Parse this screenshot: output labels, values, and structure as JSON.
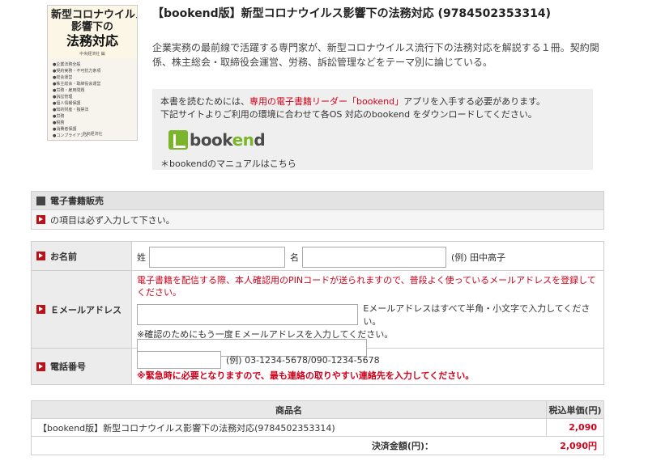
{
  "book": {
    "cover": {
      "title_line1": "新型コロナウイルス",
      "title_line2": "影響下の",
      "title_line3": "法務対応",
      "editor": "中央経済社 編",
      "contents": [
        "●企業法務全般",
        "●契約実務・不可抗力条項",
        "●総会運営",
        "●株主総会・取締役会運営",
        "●労務・雇用問題",
        "●訴訟管理",
        "●個人情報保護",
        "●知的財産・独禁法",
        "●労務",
        "●税務",
        "●消費者保護",
        "●コンプライアンス"
      ],
      "publisher": "中央経済社"
    },
    "title": "【bookend版】新型コロナウイルス影響下の法務対応 (9784502353314)",
    "description": "企業実務の最前線で活躍する専門家が、新型コロナウイルス流行下の法務対応を解説する１冊。契約関係、株主総会・取締役会運営、労務、訴訟管理などをテーマ別に論じている。"
  },
  "bookend": {
    "line1_prefix": "本書を読むためには、",
    "line1_highlight": "専用の電子書籍リーダー「bookend」",
    "line1_suffix": "アプリを入手する必要があります。",
    "line2": "下記サイトよりご利用の環境に合わせて各OS 対応のbookend をダウンロードしてください。",
    "logo_text_a": "book",
    "logo_text_b": "en",
    "logo_text_c": "d",
    "manual_link": "＊bookendのマニュアルはこちら"
  },
  "section": {
    "title": "電子書籍販売",
    "required_note": "の項目は必ず入力して下さい。"
  },
  "form": {
    "name": {
      "label": "お名前",
      "last_label": "姓",
      "first_label": "名",
      "example": "(例) 田中高子",
      "last_value": "",
      "first_value": ""
    },
    "email": {
      "label": "Ｅメールアドレス",
      "warning": "電子書籍を配信する際、本人確認用のPINコードが送られますので、普段よく使っているメールアドレスを登録してください。",
      "hint": "Eメールアドレスはすべて半角・小文字で入力してください。",
      "confirm_note": "※確認のためにもう一度Ｅメールアドレスを入力してください。",
      "value": "",
      "confirm_value": ""
    },
    "phone": {
      "label": "電話番号",
      "example": "(例) 03-1234-5678/090-1234-5678",
      "warning": "※緊急時に必要となりますので、最も連絡の取りやすい連絡先を入力してください。",
      "value": ""
    }
  },
  "order": {
    "header_item": "商品名",
    "header_price": "税込単価(円)",
    "item_name": "【bookend版】新型コロナウイルス影響下の法務対応(9784502353314)",
    "item_price": "2,090",
    "total_label": "決済金額(円)：",
    "total_value": "2,090円"
  },
  "colors": {
    "accent_red": "#d0021b",
    "bookend_green": "#7bb52c",
    "marker_red": "#b9121b"
  }
}
